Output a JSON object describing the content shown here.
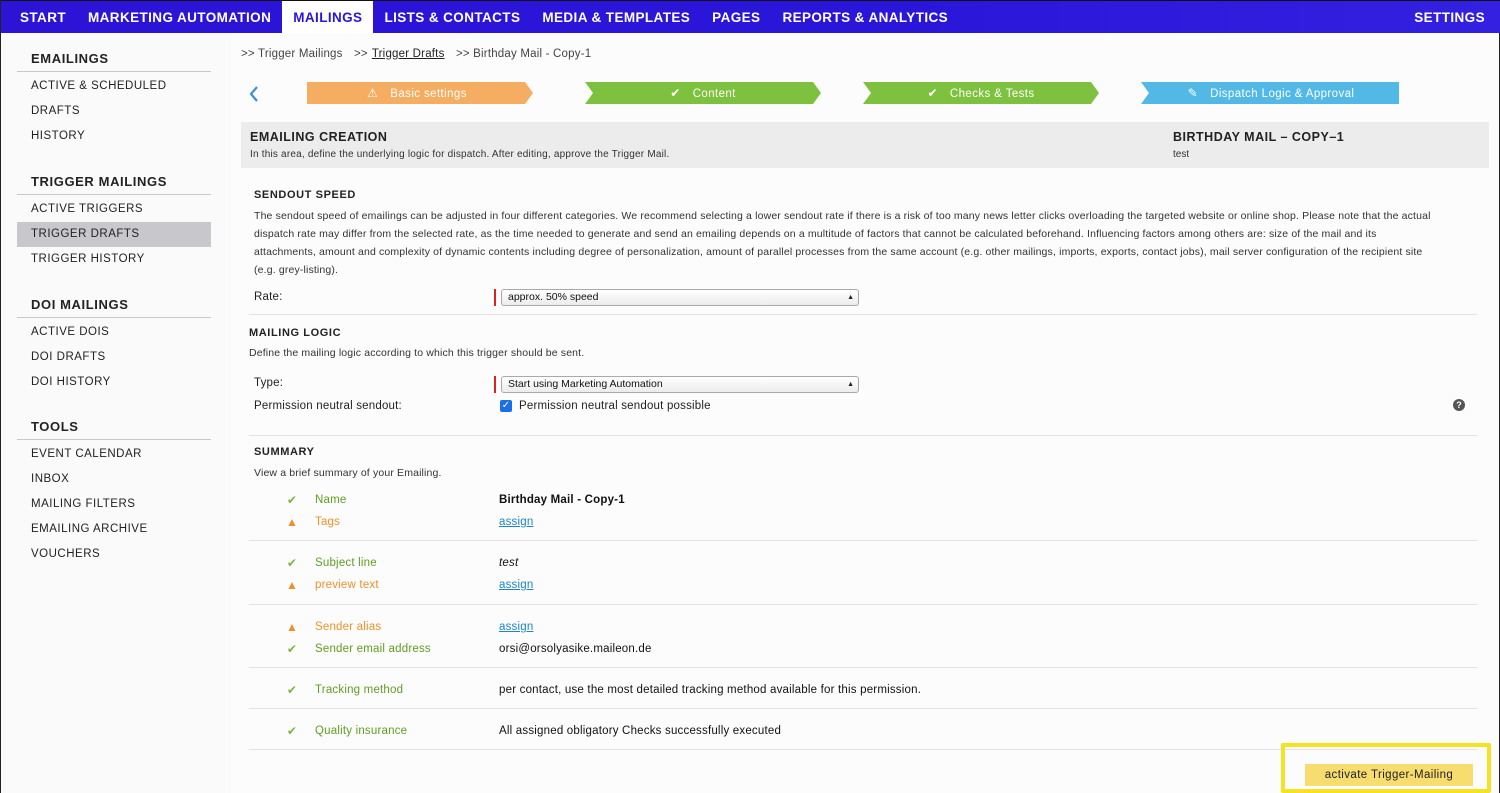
{
  "nav": {
    "items": [
      "START",
      "MARKETING AUTOMATION",
      "MAILINGS",
      "LISTS & CONTACTS",
      "MEDIA & TEMPLATES",
      "PAGES",
      "REPORTS & ANALYTICS"
    ],
    "active_index": 2,
    "settings": "SETTINGS"
  },
  "sidebar": {
    "sections": [
      {
        "heading": "EMAILINGS",
        "items": [
          "ACTIVE & SCHEDULED",
          "DRAFTS",
          "HISTORY"
        ]
      },
      {
        "heading": "TRIGGER MAILINGS",
        "items": [
          "ACTIVE TRIGGERS",
          "TRIGGER DRAFTS",
          "TRIGGER HISTORY"
        ]
      },
      {
        "heading": "DOI MAILINGS",
        "items": [
          "ACTIVE DOIS",
          "DOI DRAFTS",
          "DOI HISTORY"
        ]
      },
      {
        "heading": "TOOLS",
        "items": [
          "EVENT CALENDAR",
          "INBOX",
          "MAILING FILTERS",
          "EMAILING ARCHIVE",
          "VOUCHERS"
        ]
      }
    ],
    "active_item": "TRIGGER DRAFTS"
  },
  "breadcrumb": {
    "first": ">> Trigger Mailings",
    "sep2": ">>",
    "second": "Trigger Drafts",
    "third": ">> Birthday Mail - Copy-1"
  },
  "steps": [
    {
      "label": "Basic settings",
      "icon": "warning-icon",
      "color": "#f5ad62"
    },
    {
      "label": "Content",
      "icon": "check-icon",
      "color": "#7ec13f"
    },
    {
      "label": "Checks & Tests",
      "icon": "check-icon",
      "color": "#7ec13f"
    },
    {
      "label": "Dispatch Logic & Approval",
      "icon": "pencil-icon",
      "color": "#52b8e6"
    }
  ],
  "creation": {
    "heading": "EMAILING CREATION",
    "description": "In this area, define the underlying logic for dispatch. After editing, approve the Trigger Mail.",
    "mail_title": "BIRTHDAY MAIL – COPY–1",
    "mail_subject": "test"
  },
  "sendout": {
    "heading": "SENDOUT SPEED",
    "line1": "The sendout speed of emailings can be adjusted in four different categories. We recommend selecting a lower sendout rate if there is a risk of too many news letter clicks overloading the targeted website or online shop. Please note that the actual",
    "line2": "dispatch rate may differ from the selected rate, as the time needed to generate and send an emailing depends on a multitude of factors that cannot be calculated beforehand. Influencing factors among others are: size of the mail and its",
    "line3": "attachments, amount and complexity of dynamic contents including degree of personalization, amount of parallel processes from the same account (e.g. other mailings, imports, exports, contact jobs), mail server configuration of the recipient site",
    "line4": "(e.g. grey-listing).",
    "rate_label": "Rate:",
    "rate_value": "approx. 50% speed"
  },
  "logic": {
    "heading": "MAILING LOGIC",
    "description": "Define the mailing logic according to which this trigger should be sent.",
    "type_label": "Type:",
    "type_value": "Start using Marketing Automation",
    "permission_label": "Permission neutral sendout:",
    "permission_checkbox_label": "Permission neutral sendout possible",
    "permission_checked": true
  },
  "summary": {
    "heading": "SUMMARY",
    "description": "View a brief summary of your Emailing.",
    "rows": [
      {
        "status": "ok",
        "label": "Name",
        "value": "Birthday Mail - Copy-1",
        "style": "bold"
      },
      {
        "status": "warn",
        "label": "Tags",
        "value": "assign",
        "style": "link"
      },
      {
        "status": "ok",
        "label": "Subject line",
        "value": "test",
        "style": "italic"
      },
      {
        "status": "warn",
        "label": "preview text",
        "value": "assign",
        "style": "link"
      },
      {
        "status": "warn",
        "label": "Sender alias",
        "value": "assign",
        "style": "link"
      },
      {
        "status": "ok",
        "label": "Sender email address",
        "value": "orsi@orsolyasike.maileon.de",
        "style": "plain"
      },
      {
        "status": "ok",
        "label": "Tracking method",
        "value": "per contact, use the most detailed tracking method available for this permission.",
        "style": "plain"
      },
      {
        "status": "ok",
        "label": "Quality insurance",
        "value": "All assigned obligatory Checks successfully executed",
        "style": "plain"
      }
    ]
  },
  "activate_button": "activate Trigger-Mailing"
}
